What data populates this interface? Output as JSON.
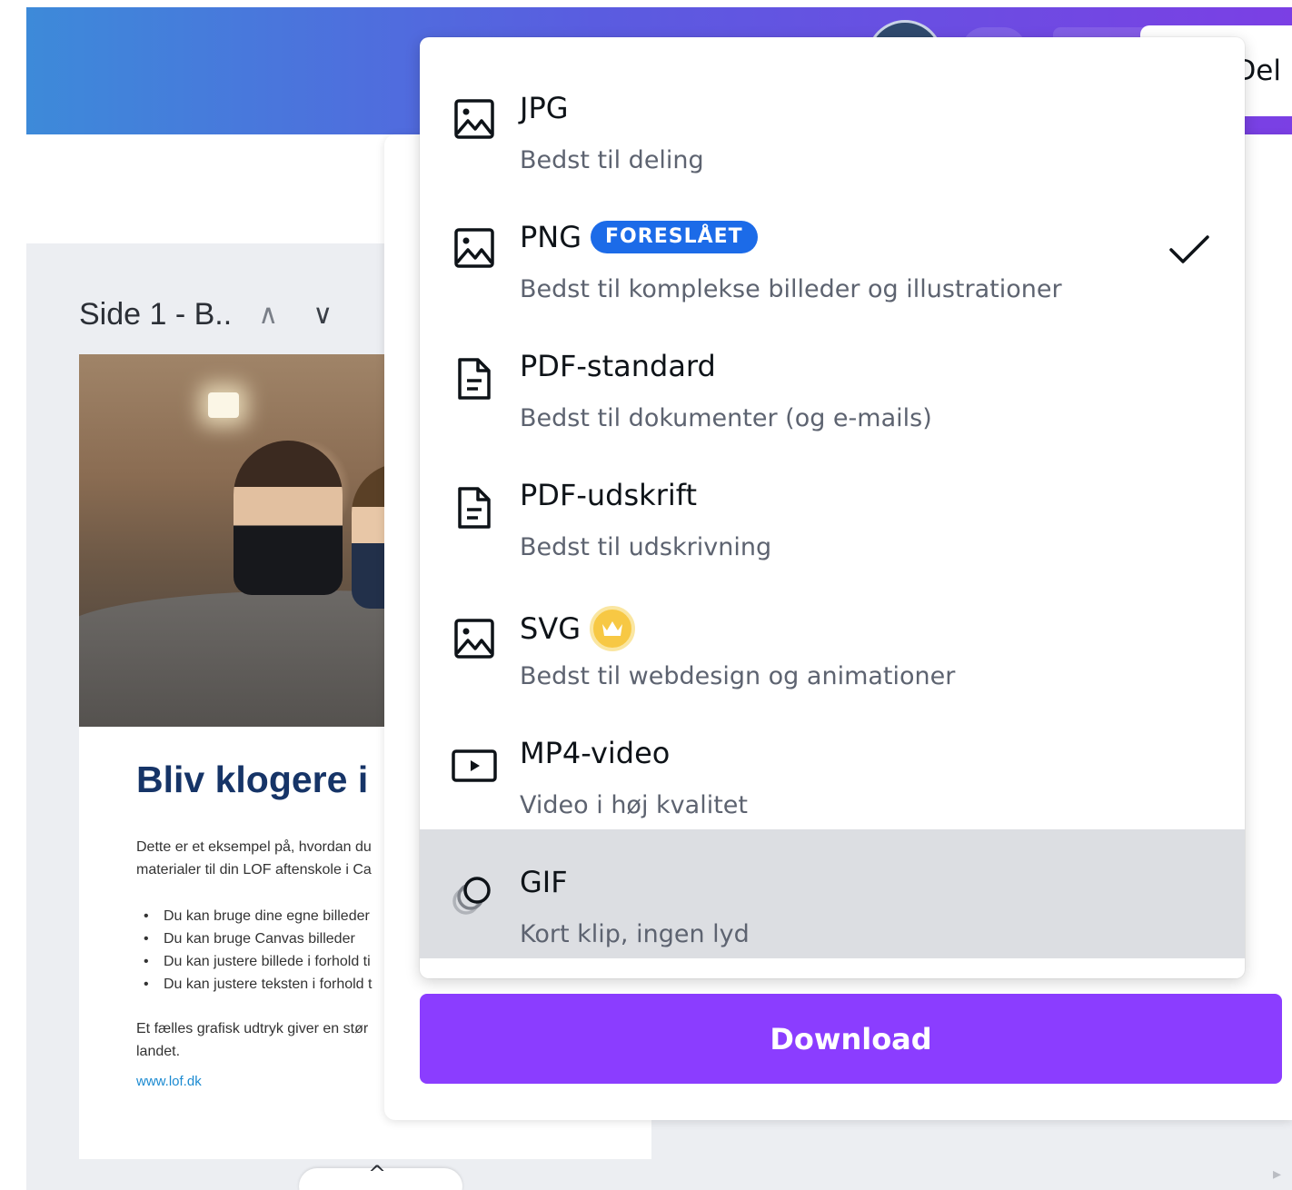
{
  "header": {
    "share_label": "Del"
  },
  "editor": {
    "page_label": "Side 1 - B..",
    "up_arrow": "∧",
    "down_arrow": "∨",
    "scroll_up_caret": "^",
    "scroll_right_arrow": "▸"
  },
  "document": {
    "heading": "Bliv klogere i",
    "paragraph_lines": [
      "Dette er et eksempel på, hvordan du",
      "materialer til din LOF aftenskole i Ca"
    ],
    "bullets": [
      "Du kan bruge dine egne billeder",
      "Du kan bruge Canvas billeder",
      "Du kan justere billede i forhold ti",
      "Du kan justere teksten i forhold t"
    ],
    "closing_lines": [
      "Et fælles grafisk udtryk giver en stør",
      "landet."
    ],
    "link": "www.lof.dk"
  },
  "format_menu": {
    "selected": "PNG",
    "hovered": "GIF",
    "items": [
      {
        "title": "JPG",
        "description": "Bedst til deling",
        "icon": "image-icon"
      },
      {
        "title": "PNG",
        "badge": "FORESLÅET",
        "description": "Bedst til komplekse billeder og illustrationer",
        "icon": "image-icon"
      },
      {
        "title": "PDF-standard",
        "description": "Bedst til dokumenter (og e-mails)",
        "icon": "document-icon"
      },
      {
        "title": "PDF-udskrift",
        "description": "Bedst til udskrivning",
        "icon": "document-icon"
      },
      {
        "title": "SVG",
        "premium": true,
        "description": "Bedst til webdesign og animationer",
        "icon": "image-icon"
      },
      {
        "title": "MP4-video",
        "description": "Video i høj kvalitet",
        "icon": "video-icon"
      },
      {
        "title": "GIF",
        "description": "Kort klip, ingen lyd",
        "icon": "gif-icon"
      }
    ]
  },
  "download": {
    "label": "Download"
  },
  "colors": {
    "accent_purple": "#8b3dff",
    "badge_blue": "#1c6be8",
    "premium_gold": "#f7c844",
    "heading_navy": "#163467"
  }
}
